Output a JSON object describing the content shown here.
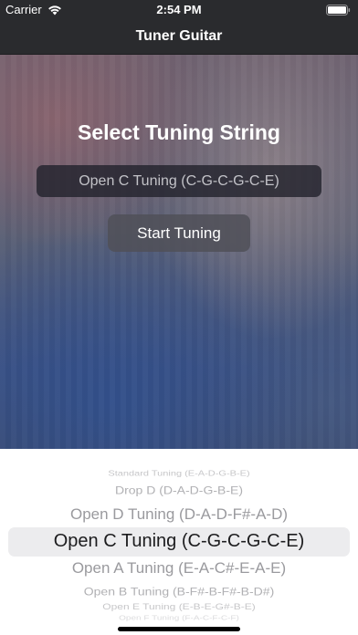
{
  "status_bar": {
    "carrier": "Carrier",
    "time": "2:54 PM",
    "wifi_icon": "wifi-icon",
    "battery_icon": "battery-icon"
  },
  "nav": {
    "title": "Tuner Guitar"
  },
  "main": {
    "heading": "Select Tuning String",
    "selected_tuning": "Open C Tuning (C-G-C-G-C-E)",
    "start_button_label": "Start Tuning"
  },
  "picker": {
    "options": [
      "Standard Tuning (E-A-D-G-B-E)",
      "Drop D (D-A-D-G-B-E)",
      "Open D Tuning (D-A-D-F#-A-D)",
      "Open C Tuning (C-G-C-G-C-E)",
      "Open A Tuning (E-A-C#-E-A-E)",
      "Open B Tuning (B-F#-B-F#-B-D#)",
      "Open E Tuning (E-B-E-G#-B-E)",
      "Open F Tuning (F-A-C-F-C-F)"
    ],
    "selected": "Open C Tuning (C-G-C-G-C-E)"
  },
  "colors": {
    "bar_background": "#2a2b2e",
    "picker_background": "#ffffff",
    "picker_highlight": "#ececee"
  }
}
